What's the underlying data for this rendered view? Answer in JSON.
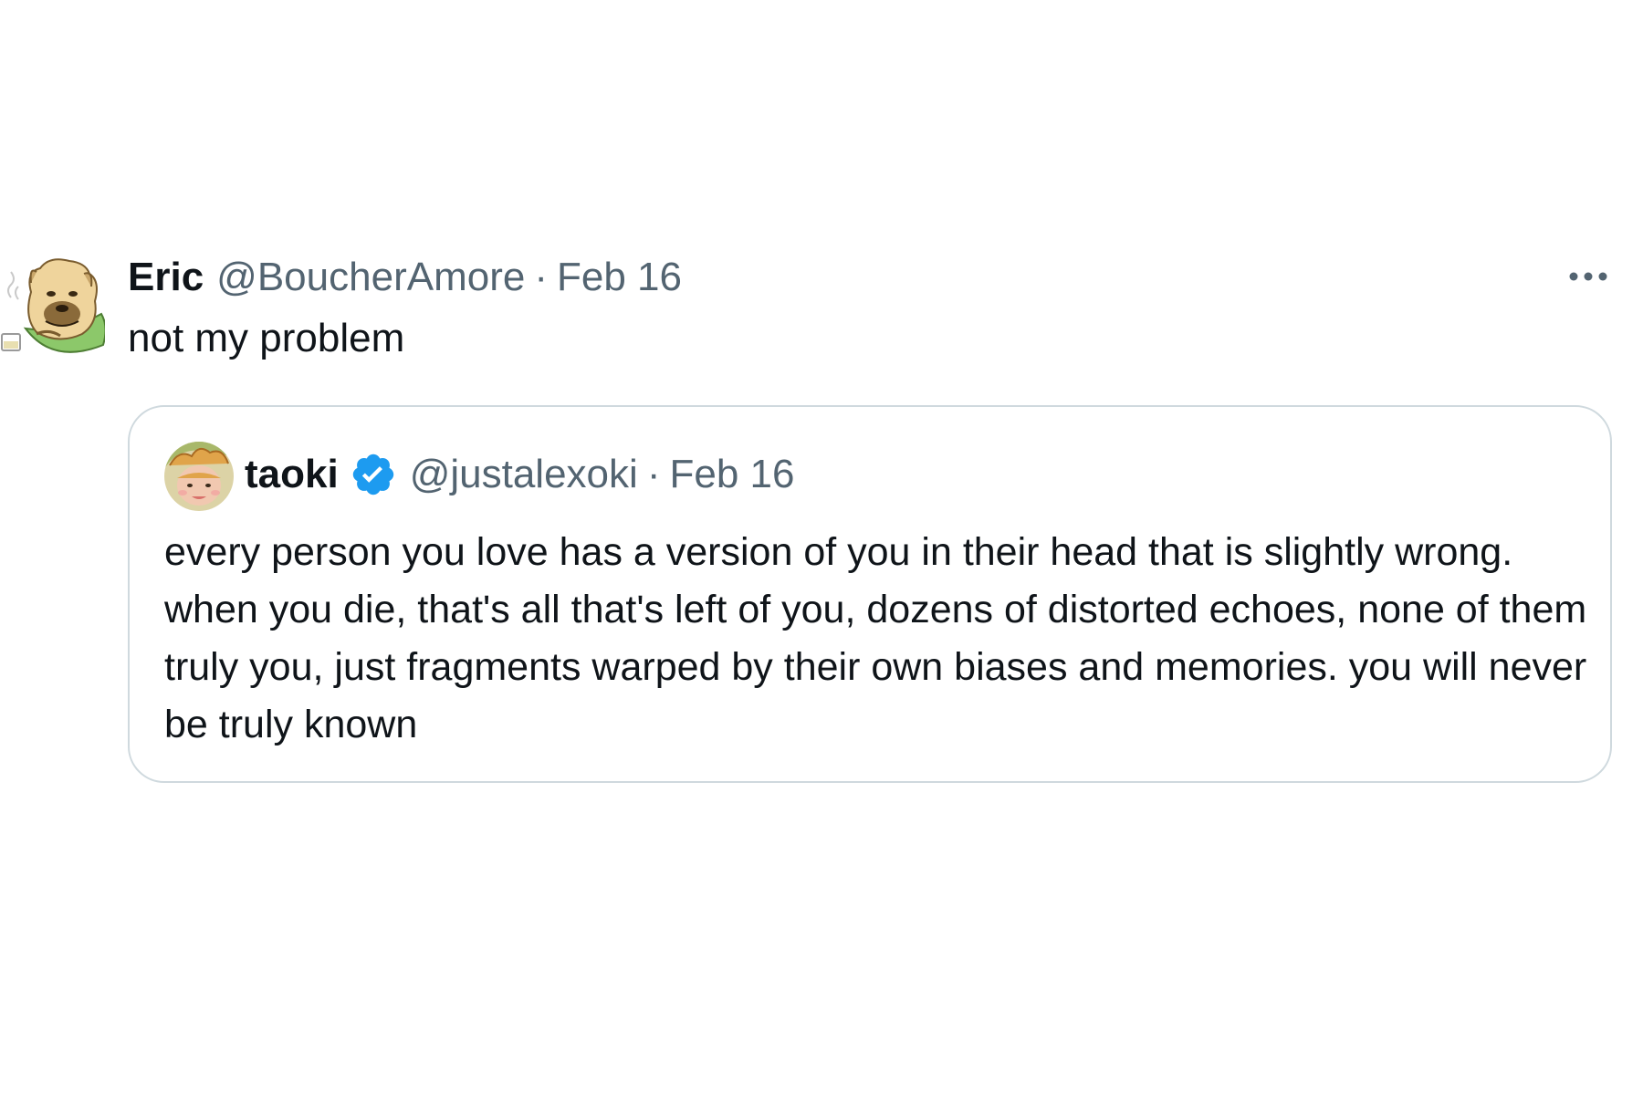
{
  "tweet": {
    "author_name": "Eric",
    "author_handle": "@BoucherAmore",
    "separator": "·",
    "date": "Feb 16",
    "text": "not my problem",
    "avatar_icon": "cartoon-pug-avatar-icon",
    "more_icon": "more-options-icon"
  },
  "quote": {
    "author_name": "taoki",
    "author_handle": "@justalexoki",
    "separator": "·",
    "date": "Feb 16",
    "verified_icon": "verified-badge-icon",
    "avatar_icon": "cartoon-avatar-icon",
    "text": "every person you love has a version of you in their head that is slightly wrong. when you die, that's all that's left of you, dozens of distorted echoes, none of them truly you, just fragments warped by their own biases and memories. you will never be truly known"
  },
  "colors": {
    "text_primary": "#0f1419",
    "text_secondary": "#536471",
    "border": "#cfd9de",
    "verified_blue": "#1d9bf0"
  }
}
